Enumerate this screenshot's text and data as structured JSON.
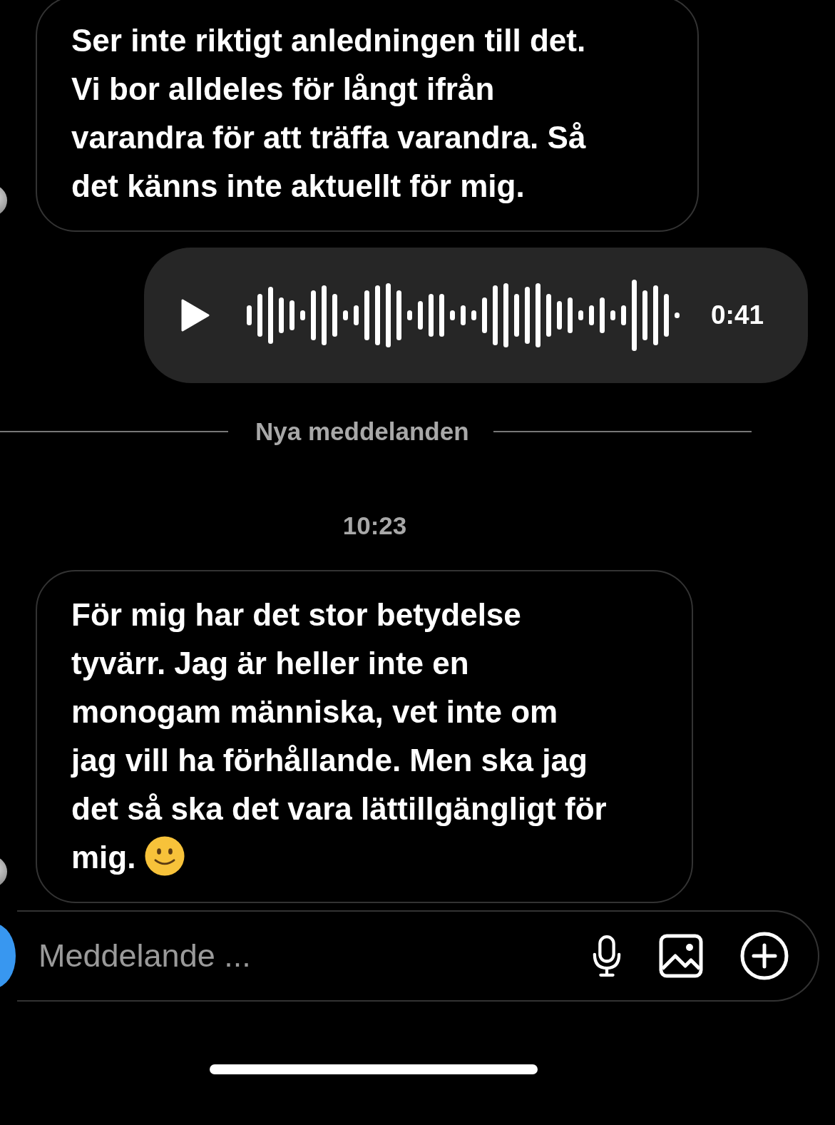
{
  "thread": [
    {
      "kind": "text",
      "text": "Ser inte riktigt anledningen till det. Vi bor alldeles för långt ifrån varandra för att träffa varandra. Så det känns inte aktuellt för mig.",
      "emoji": false
    },
    {
      "kind": "voice",
      "duration": "0:41"
    },
    {
      "kind": "divider",
      "label": "Nya meddelanden"
    },
    {
      "kind": "time",
      "label": "10:23"
    },
    {
      "kind": "text",
      "text": "För mig har det stor betydelse tyvärr. Jag är heller inte en monogam människa, vet inte om jag vill ha förhållande. Men ska jag det så ska det vara lättillgängligt för mig.",
      "emoji": true
    }
  ],
  "composer": {
    "placeholder": "Meddelande ..."
  }
}
